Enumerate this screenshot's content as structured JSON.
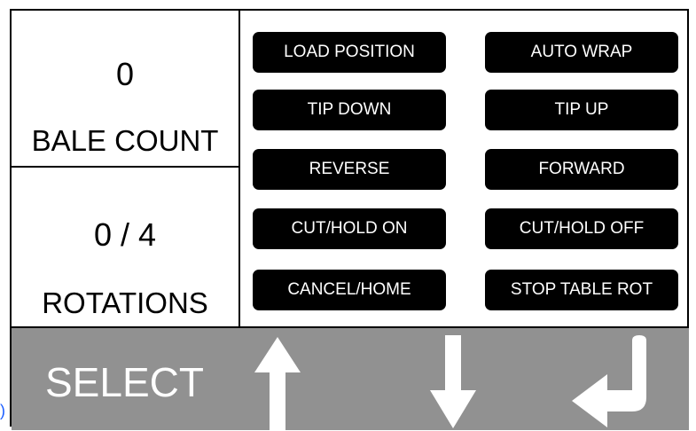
{
  "bale_count": {
    "value": "0",
    "label": "BALE COUNT"
  },
  "rotations": {
    "value": "0 / 4",
    "label": "ROTATIONS"
  },
  "buttons": {
    "load_position": "LOAD POSITION",
    "auto_wrap": "AUTO WRAP",
    "tip_down": "TIP DOWN",
    "tip_up": "TIP UP",
    "reverse": "REVERSE",
    "forward": "FORWARD",
    "cut_hold_on": "CUT/HOLD ON",
    "cut_hold_off": "CUT/HOLD OFF",
    "cancel_home": "CANCEL/HOME",
    "stop_table_rot": "STOP TABLE ROT"
  },
  "bottom_bar": {
    "select_label": "SELECT",
    "icons": [
      "arrow-up-icon",
      "arrow-down-icon",
      "enter-icon"
    ]
  },
  "edge_glyph": ")",
  "colors": {
    "button_bg": "#000000",
    "button_text": "#ffffff",
    "bottom_bar_bg": "#919191",
    "icon_color": "#ffffff"
  }
}
